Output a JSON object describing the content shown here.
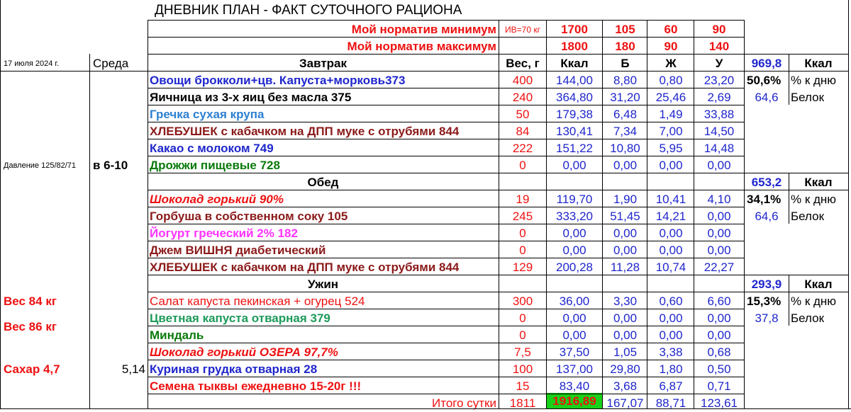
{
  "title": "ДНЕВНИК ПЛАН - ФАКТ СУТОЧНОГО РАЦИОНА",
  "norms": {
    "min_label": "Мой норматив минимум",
    "iv_label": "ИВ=70 кг",
    "min": [
      "1700",
      "105",
      "60",
      "90"
    ],
    "max_label": "Мой норматив максимум",
    "max": [
      "1800",
      "180",
      "90",
      "140"
    ]
  },
  "left": {
    "date": "17 июля 2024 г.",
    "weekday": "Среда",
    "pressure": "Давление 125/82/71",
    "pressure_time": "в 6-10",
    "weight1": "Вес  84 кг",
    "weight2": "Вес 86 кг",
    "sugar": "Сахар 4,7",
    "sugar_value": "5,14"
  },
  "header": {
    "weight": "Вес, г",
    "kcal": "Ккал",
    "b": "Б",
    "zh": "Ж",
    "u": "У"
  },
  "meals": {
    "breakfast": {
      "title": "Завтрак",
      "total": "969,8",
      "unit": "Ккал",
      "percent": "50,6%",
      "percent_label": "% к дню",
      "protein": "64,6",
      "protein_label": "Белок"
    },
    "lunch": {
      "title": "Обед",
      "total": "653,2",
      "unit": "Ккал",
      "percent": "34,1%",
      "percent_label": "% к дню",
      "protein": "64,6",
      "protein_label": "Белок"
    },
    "dinner": {
      "title": "Ужин",
      "total": "293,9",
      "unit": "Ккал",
      "percent": "15,3%",
      "percent_label": "% к дню",
      "protein": "37,8",
      "protein_label": "Белок"
    }
  },
  "rows": [
    [
      "Овощи брокколи+цв. Капуста+морковь373",
      "400",
      "144,00",
      "8,80",
      "0,80",
      "23,20"
    ],
    [
      "Яичница из 3-х яиц без масла 375",
      "240",
      "364,80",
      "31,20",
      "25,46",
      "2,69"
    ],
    [
      "Гречка сухая крупа",
      "50",
      "179,38",
      "6,48",
      "1,49",
      "33,88"
    ],
    [
      "ХЛЕБУШЕК с кабачком на ДПП муке с отрубями 844",
      "84",
      "130,41",
      "7,34",
      "7,00",
      "14,50"
    ],
    [
      "Какао с молоком 749",
      "222",
      "151,22",
      "10,80",
      "5,95",
      "14,48"
    ],
    [
      "Дрожжи пищевые 728",
      "0",
      "0,00",
      "0,00",
      "0,00",
      "0,00"
    ],
    [
      "Шоколад горький 90%",
      "19",
      "119,70",
      "1,90",
      "10,41",
      "4,10"
    ],
    [
      "Горбуша в собственном соку 105",
      "245",
      "333,20",
      "51,45",
      "14,21",
      "0,00"
    ],
    [
      "Йогурт греческий 2% 182",
      "0",
      "0,00",
      "0,00",
      "0,00",
      "0,00"
    ],
    [
      "Джем ВИШНЯ диабетический",
      "0",
      "0,00",
      "0,00",
      "0,00",
      "0,00"
    ],
    [
      "ХЛЕБУШЕК с кабачком на ДПП муке с отрубями 844",
      "129",
      "200,28",
      "11,28",
      "10,74",
      "22,27"
    ],
    [
      "Салат капуста пекинская + огурец  524",
      "300",
      "36,00",
      "3,30",
      "0,60",
      "6,60"
    ],
    [
      "Цветная капуста отварная 379",
      "0",
      "0,00",
      "0,00",
      "0,00",
      "0,00"
    ],
    [
      "Миндаль",
      "0",
      "0,00",
      "0,00",
      "0,00",
      "0,00"
    ],
    [
      "Шоколад горький ОЗЕРА 97,7%",
      "7,5",
      "37,50",
      "1,05",
      "3,38",
      "0,68"
    ],
    [
      "Куриная грудка отварная 28",
      "100",
      "137,00",
      "29,80",
      "1,80",
      "0,50"
    ],
    [
      "Семена тыквы ежедневно 15-20г !!!",
      "15",
      "83,40",
      "3,68",
      "6,87",
      "0,71"
    ]
  ],
  "totals": {
    "label": "Итого сутки",
    "weight": "1811",
    "kcal": "1916,89",
    "b": "167,07",
    "zh": "88,71",
    "u": "123,61"
  },
  "colors": {
    "blue": "#1f26cc",
    "red": "#ee1111",
    "dark_red": "#8b1a1a",
    "green": "#0a7a0a",
    "highlight": "#19d119"
  }
}
